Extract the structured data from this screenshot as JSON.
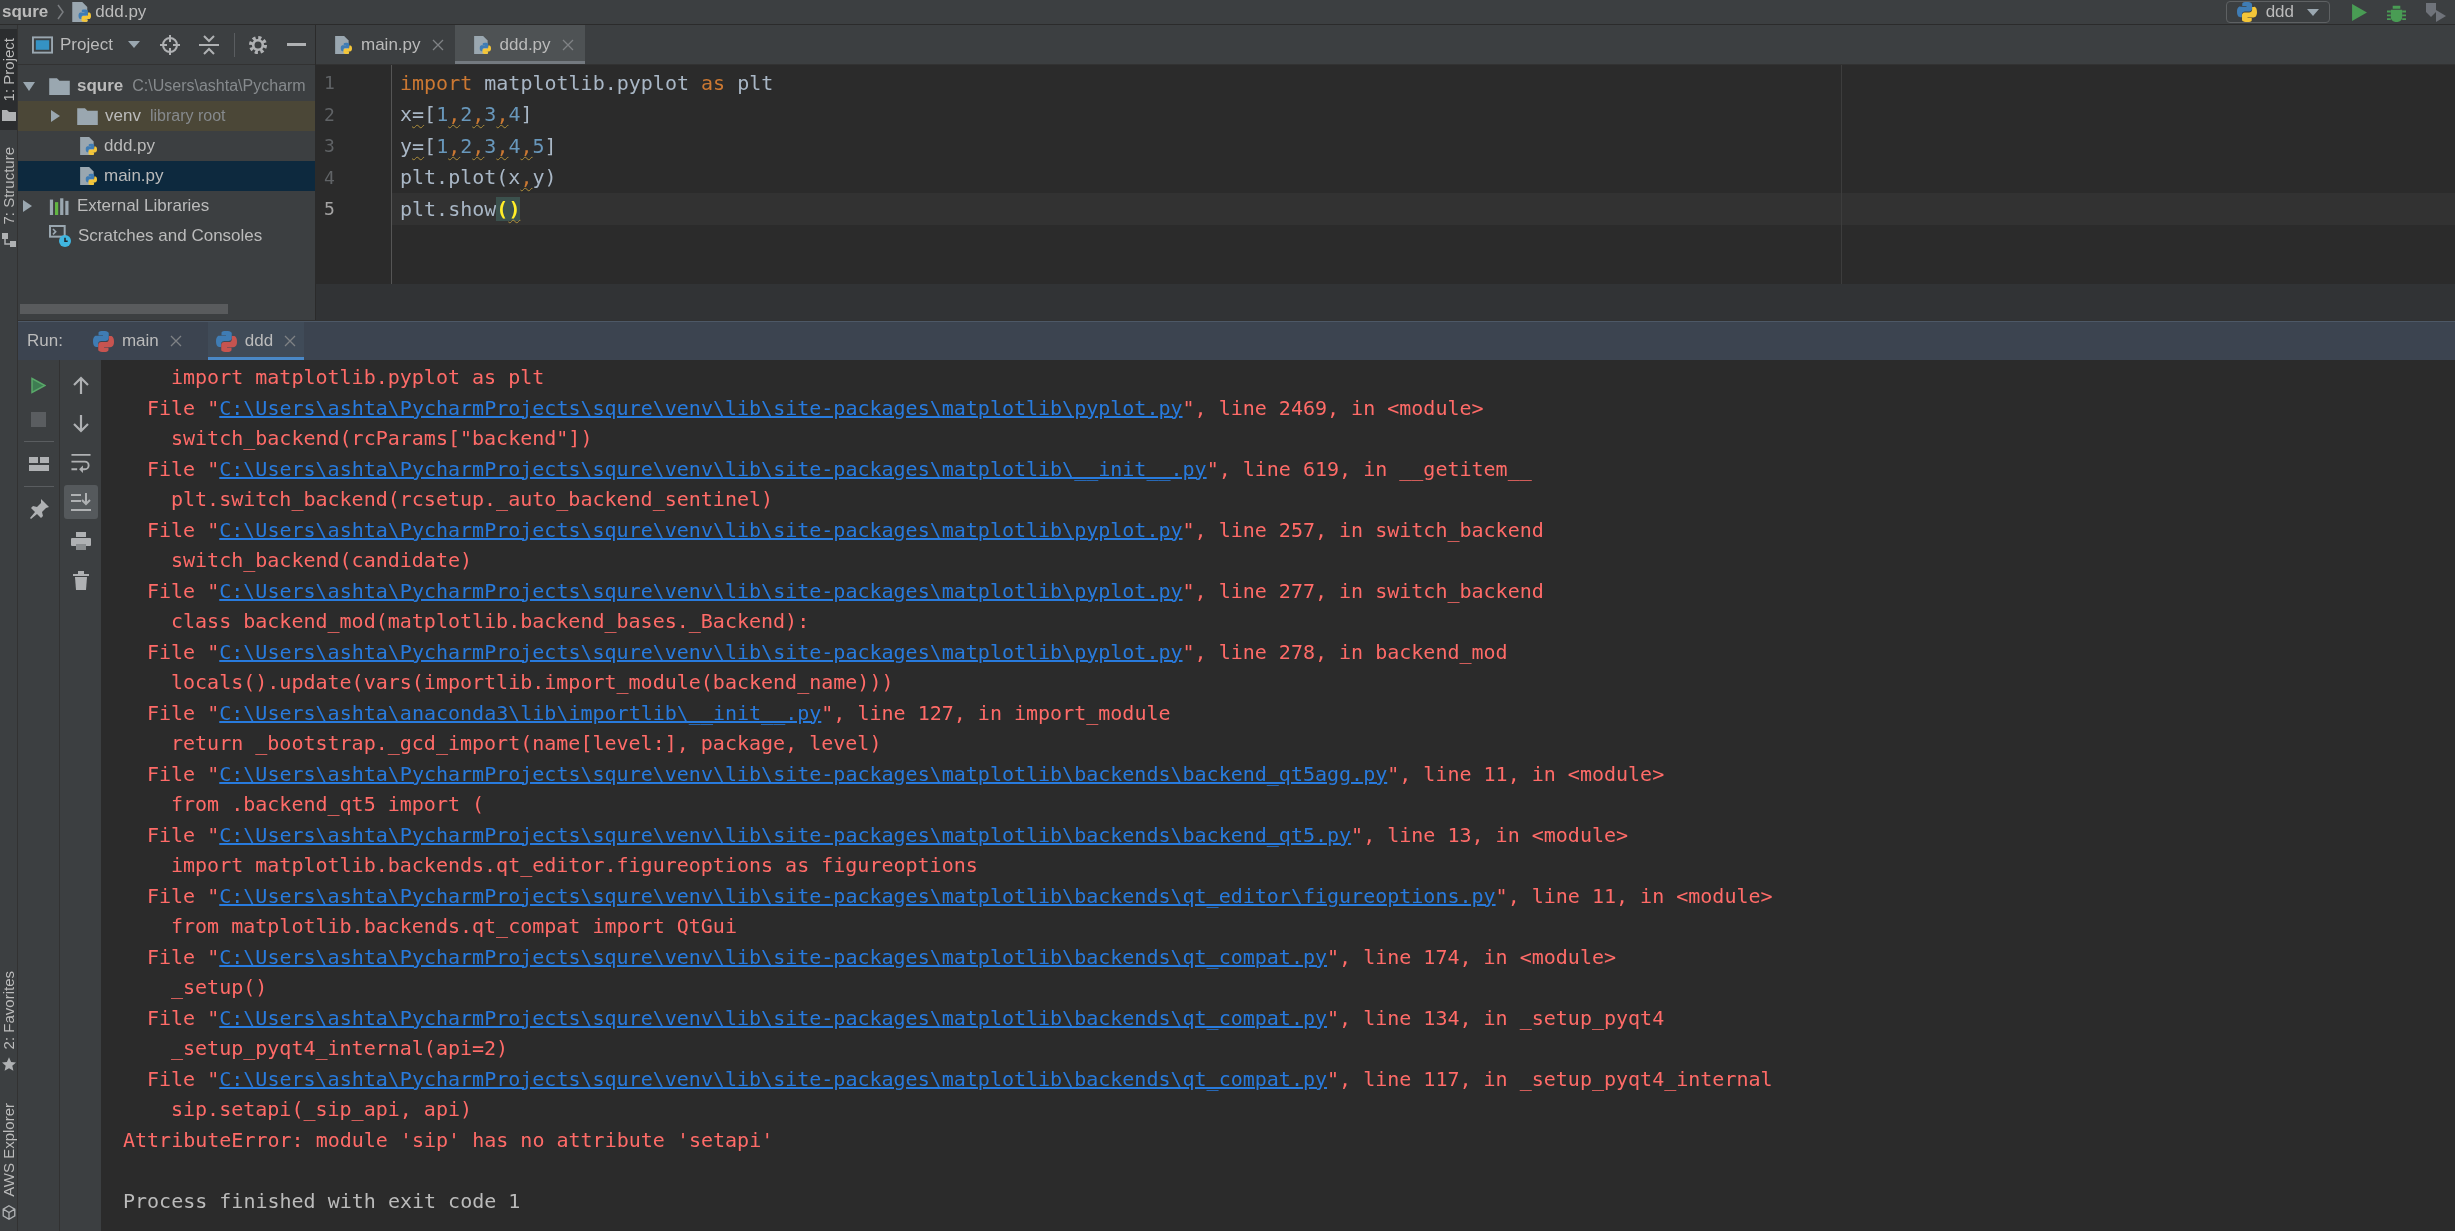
{
  "navigation_bar": {
    "breadcrumbs": [
      {
        "label": "squre",
        "kind": "project"
      },
      {
        "label": "ddd.py",
        "kind": "python_file"
      }
    ],
    "run_config": {
      "label": "ddd"
    }
  },
  "tool_strip": {
    "top": [
      {
        "label": "1: Project",
        "kind": "project",
        "selected": true
      },
      {
        "label": "7: Structure",
        "kind": "structure",
        "selected": false
      }
    ],
    "bottom": [
      {
        "label": "2: Favorites",
        "kind": "favorites",
        "selected": false
      },
      {
        "label": "AWS Explorer",
        "kind": "aws",
        "selected": false
      }
    ]
  },
  "project": {
    "title": "Project",
    "tree": [
      {
        "label": "squre",
        "hint": "C:\\Users\\ashta\\Pycharm",
        "kind": "project_folder",
        "expanded": true,
        "selected": false,
        "children": [
          {
            "label": "venv",
            "hint": "library root",
            "kind": "library_root",
            "expanded": false,
            "selected": false
          },
          {
            "label": "ddd.py",
            "kind": "python_file",
            "selected": false
          },
          {
            "label": "main.py",
            "kind": "python_file",
            "selected": true
          }
        ]
      },
      {
        "label": "External Libraries",
        "kind": "libraries",
        "expanded": false,
        "selected": false
      },
      {
        "label": "Scratches and Consoles",
        "kind": "scratches",
        "selected": false
      }
    ]
  },
  "editor": {
    "tabs": [
      {
        "label": "main.py",
        "selected": false
      },
      {
        "label": "ddd.py",
        "selected": true
      }
    ],
    "lines": [
      {
        "number": "1",
        "current": false,
        "tokens": [
          {
            "text": "import",
            "kind": "keyword",
            "warning": false
          },
          {
            "text": " matplotlib.pyplot ",
            "kind": "plain",
            "warning": false
          },
          {
            "text": "as",
            "kind": "keyword",
            "warning": false
          },
          {
            "text": " plt",
            "kind": "plain",
            "warning": false
          }
        ]
      },
      {
        "number": "2",
        "current": false,
        "tokens": [
          {
            "text": "x",
            "kind": "plain",
            "warning": false
          },
          {
            "text": "=",
            "kind": "plain",
            "warning": true
          },
          {
            "text": "[",
            "kind": "plain",
            "warning": false
          },
          {
            "text": "1",
            "kind": "number",
            "warning": false
          },
          {
            "text": ",",
            "kind": "comma",
            "warning": true
          },
          {
            "text": "2",
            "kind": "number",
            "warning": false
          },
          {
            "text": ",",
            "kind": "comma",
            "warning": true
          },
          {
            "text": "3",
            "kind": "number",
            "warning": false
          },
          {
            "text": ",",
            "kind": "comma",
            "warning": true
          },
          {
            "text": "4",
            "kind": "number",
            "warning": false
          },
          {
            "text": "]",
            "kind": "plain",
            "warning": false
          }
        ]
      },
      {
        "number": "3",
        "current": false,
        "tokens": [
          {
            "text": "y",
            "kind": "plain",
            "warning": false
          },
          {
            "text": "=",
            "kind": "plain",
            "warning": true
          },
          {
            "text": "[",
            "kind": "plain",
            "warning": false
          },
          {
            "text": "1",
            "kind": "number",
            "warning": false
          },
          {
            "text": ",",
            "kind": "comma",
            "warning": true
          },
          {
            "text": "2",
            "kind": "number",
            "warning": false
          },
          {
            "text": ",",
            "kind": "comma",
            "warning": true
          },
          {
            "text": "3",
            "kind": "number",
            "warning": false
          },
          {
            "text": ",",
            "kind": "comma",
            "warning": true
          },
          {
            "text": "4",
            "kind": "number",
            "warning": false
          },
          {
            "text": ",",
            "kind": "comma",
            "warning": true
          },
          {
            "text": "5",
            "kind": "number",
            "warning": false
          },
          {
            "text": "]",
            "kind": "plain",
            "warning": false
          }
        ]
      },
      {
        "number": "4",
        "current": false,
        "tokens": [
          {
            "text": "plt.plot(x",
            "kind": "plain",
            "warning": false
          },
          {
            "text": ",",
            "kind": "comma",
            "warning": true
          },
          {
            "text": "y)",
            "kind": "plain",
            "warning": false
          }
        ]
      },
      {
        "number": "5",
        "current": true,
        "tokens": [
          {
            "text": "plt.show",
            "kind": "plain",
            "warning": false
          },
          {
            "text": "(",
            "kind": "brace_match",
            "warning": false
          },
          {
            "text": ")",
            "kind": "brace_match",
            "warning": true
          }
        ]
      }
    ]
  },
  "run": {
    "title": "Run:",
    "tabs": [
      {
        "label": "main",
        "selected": false
      },
      {
        "label": "ddd",
        "selected": true
      }
    ],
    "toolbar_left": [
      {
        "kind": "rerun",
        "disabled": false
      },
      {
        "kind": "stop",
        "disabled": true
      },
      {
        "kind": "layout",
        "disabled": false
      },
      {
        "kind": "pin",
        "disabled": false
      }
    ],
    "toolbar_right": [
      {
        "kind": "up",
        "on": false
      },
      {
        "kind": "down",
        "on": false
      },
      {
        "kind": "soft_wrap",
        "on": false
      },
      {
        "kind": "scroll_to_end",
        "on": true
      },
      {
        "kind": "print",
        "on": false
      },
      {
        "kind": "clear",
        "on": false
      }
    ],
    "console": [
      {
        "kind": "code",
        "text": "import matplotlib.pyplot as plt"
      },
      {
        "kind": "file",
        "prefix": "File \"",
        "path": "C:\\Users\\ashta\\PycharmProjects\\squre\\venv\\lib\\site-packages\\matplotlib\\pyplot.py",
        "suffix": "\", line 2469, in <module>"
      },
      {
        "kind": "code",
        "text": "switch_backend(rcParams[\"backend\"])"
      },
      {
        "kind": "file",
        "prefix": "File \"",
        "path": "C:\\Users\\ashta\\PycharmProjects\\squre\\venv\\lib\\site-packages\\matplotlib\\__init__.py",
        "suffix": "\", line 619, in __getitem__"
      },
      {
        "kind": "code",
        "text": "plt.switch_backend(rcsetup._auto_backend_sentinel)"
      },
      {
        "kind": "file",
        "prefix": "File \"",
        "path": "C:\\Users\\ashta\\PycharmProjects\\squre\\venv\\lib\\site-packages\\matplotlib\\pyplot.py",
        "suffix": "\", line 257, in switch_backend"
      },
      {
        "kind": "code",
        "text": "switch_backend(candidate)"
      },
      {
        "kind": "file",
        "prefix": "File \"",
        "path": "C:\\Users\\ashta\\PycharmProjects\\squre\\venv\\lib\\site-packages\\matplotlib\\pyplot.py",
        "suffix": "\", line 277, in switch_backend"
      },
      {
        "kind": "code",
        "text": "class backend_mod(matplotlib.backend_bases._Backend):"
      },
      {
        "kind": "file",
        "prefix": "File \"",
        "path": "C:\\Users\\ashta\\PycharmProjects\\squre\\venv\\lib\\site-packages\\matplotlib\\pyplot.py",
        "suffix": "\", line 278, in backend_mod"
      },
      {
        "kind": "code",
        "text": "locals().update(vars(importlib.import_module(backend_name)))"
      },
      {
        "kind": "file",
        "prefix": "File \"",
        "path": "C:\\Users\\ashta\\anaconda3\\lib\\importlib\\__init__.py",
        "suffix": "\", line 127, in import_module"
      },
      {
        "kind": "code",
        "text": "return _bootstrap._gcd_import(name[level:], package, level)"
      },
      {
        "kind": "file",
        "prefix": "File \"",
        "path": "C:\\Users\\ashta\\PycharmProjects\\squre\\venv\\lib\\site-packages\\matplotlib\\backends\\backend_qt5agg.py",
        "suffix": "\", line 11, in <module>"
      },
      {
        "kind": "code",
        "text": "from .backend_qt5 import ("
      },
      {
        "kind": "file",
        "prefix": "File \"",
        "path": "C:\\Users\\ashta\\PycharmProjects\\squre\\venv\\lib\\site-packages\\matplotlib\\backends\\backend_qt5.py",
        "suffix": "\", line 13, in <module>"
      },
      {
        "kind": "code",
        "text": "import matplotlib.backends.qt_editor.figureoptions as figureoptions"
      },
      {
        "kind": "file",
        "prefix": "File \"",
        "path": "C:\\Users\\ashta\\PycharmProjects\\squre\\venv\\lib\\site-packages\\matplotlib\\backends\\qt_editor\\figureoptions.py",
        "suffix": "\", line 11, in <module>"
      },
      {
        "kind": "code",
        "text": "from matplotlib.backends.qt_compat import QtGui"
      },
      {
        "kind": "file",
        "prefix": "File \"",
        "path": "C:\\Users\\ashta\\PycharmProjects\\squre\\venv\\lib\\site-packages\\matplotlib\\backends\\qt_compat.py",
        "suffix": "\", line 174, in <module>"
      },
      {
        "kind": "code",
        "text": "_setup()"
      },
      {
        "kind": "file",
        "prefix": "File \"",
        "path": "C:\\Users\\ashta\\PycharmProjects\\squre\\venv\\lib\\site-packages\\matplotlib\\backends\\qt_compat.py",
        "suffix": "\", line 134, in _setup_pyqt4"
      },
      {
        "kind": "code",
        "text": "_setup_pyqt4_internal(api=2)"
      },
      {
        "kind": "file",
        "prefix": "File \"",
        "path": "C:\\Users\\ashta\\PycharmProjects\\squre\\venv\\lib\\site-packages\\matplotlib\\backends\\qt_compat.py",
        "suffix": "\", line 117, in _setup_pyqt4_internal"
      },
      {
        "kind": "code",
        "text": "sip.setapi(_sip_api, api)"
      },
      {
        "kind": "error",
        "text": "AttributeError: module 'sip' has no attribute 'setapi'"
      },
      {
        "kind": "blank"
      },
      {
        "kind": "info",
        "text": "Process finished with exit code 1"
      }
    ]
  }
}
